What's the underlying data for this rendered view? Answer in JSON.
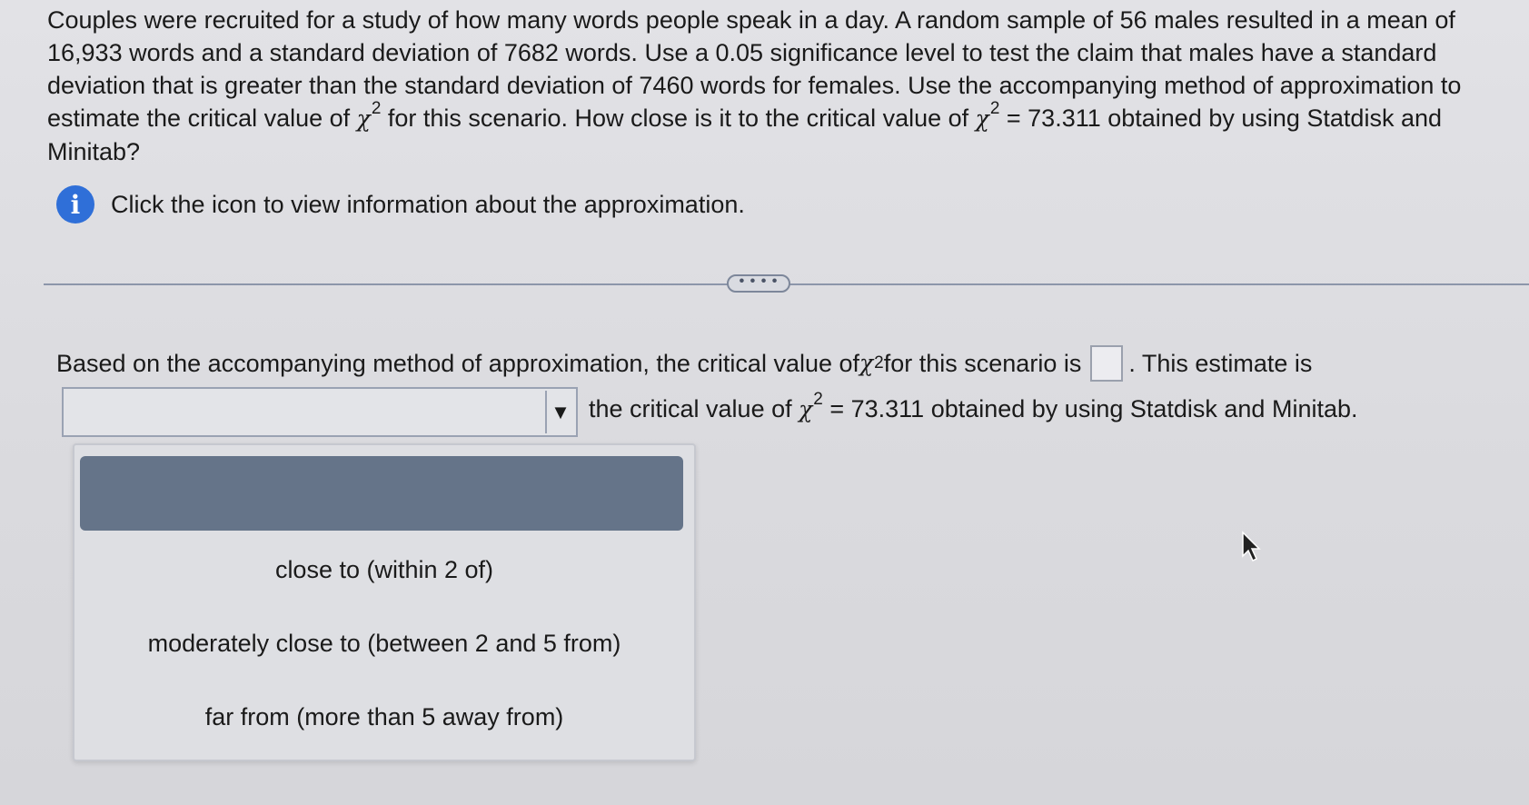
{
  "question": {
    "text_part1": "Couples were recruited for a study of how many words people speak in a day. A random sample of 56 males resulted in a mean of 16,933 words and a standard deviation of 7682 words. Use a 0.05 significance level to test the claim that males have a standard deviation that is greater than the standard deviation of 7460 words for females. Use the accompanying method of approximation to estimate the critical value of ",
    "chi_symbol": "χ",
    "exponent": "2",
    "text_part2": " for this scenario. How close is it to the critical value of ",
    "text_part3": " = 73.311 obtained by using Statdisk and Minitab?"
  },
  "info": {
    "icon_glyph": "i",
    "label": "Click the icon to view information about the approximation."
  },
  "more_button": {
    "label": "• • • •"
  },
  "answer": {
    "line1_part1": "Based on the accompanying method of approximation, the critical value of ",
    "line1_part2": " for this scenario is ",
    "line1_part3": ". This estimate is",
    "input_value": "",
    "line2_part1": "the critical value of ",
    "line2_part2": " = 73.311 obtained by using Statdisk and Minitab.",
    "select_value": "",
    "select_arrow": "▼"
  },
  "dropdown": {
    "highlighted_option": "",
    "options": [
      "close to (within 2 of)",
      "moderately close to (between 2 and 5 from)",
      "far from (more than 5 away from)"
    ]
  },
  "colors": {
    "info_icon": "#2f6fd8",
    "highlight": "#657489",
    "divider": "#8c96aa"
  }
}
